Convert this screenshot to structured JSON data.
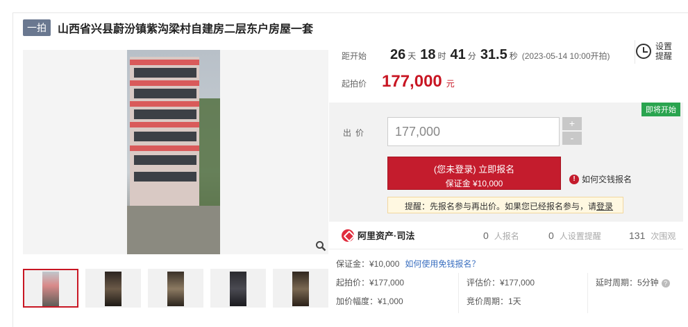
{
  "header": {
    "round_badge": "一拍",
    "title": "山西省兴县蔚汾镇紫沟梁村自建房二层东户房屋一套"
  },
  "countdown": {
    "label": "距开始",
    "days": "26",
    "days_unit": "天",
    "hours": "18",
    "hours_unit": "时",
    "minutes": "41",
    "minutes_unit": "分",
    "seconds": "31.5",
    "seconds_unit": "秒",
    "start_time": "(2023-05-14 10:00开拍)"
  },
  "reminder": {
    "label": "设置提醒"
  },
  "start_price": {
    "label": "起拍价",
    "value": "177,000",
    "unit": "元"
  },
  "bid": {
    "soon_tag": "即将开始",
    "label": "出价",
    "input_value": "177,000",
    "plus": "+",
    "minus": "-",
    "apply_line1": "(您未登录) 立即报名",
    "apply_line2": "保证金 ¥10,000",
    "howto_icon": "!",
    "howto": "如何交钱报名",
    "hint_text": "提醒：先报名参与再出价。如果您已经报名参与，请",
    "hint_link": "登录"
  },
  "brand": {
    "name": "阿里资产·司法"
  },
  "stats": {
    "signup_count": "0",
    "signup_label": "人报名",
    "reminder_count": "0",
    "reminder_label": "人设置提醒",
    "views_count": "131",
    "views_label": "次围观"
  },
  "details": {
    "deposit": "保证金：¥10,000",
    "deposit_link": "如何使用免钱报名？",
    "start_price": "起拍价：¥177,000",
    "appraisal": "评估价：¥177,000",
    "delay": "延时周期：5分钟",
    "increment": "加价幅度：¥1,000",
    "period": "竞价周期：1天"
  },
  "icons": {
    "zoom": "magnifier-icon",
    "clock": "alarm-clock-icon",
    "info": "info-icon",
    "help": "question-icon"
  },
  "colors": {
    "accent": "#c41c2d",
    "badge": "#6a7890",
    "soon": "#2aa44f",
    "link": "#3a6fc0"
  }
}
